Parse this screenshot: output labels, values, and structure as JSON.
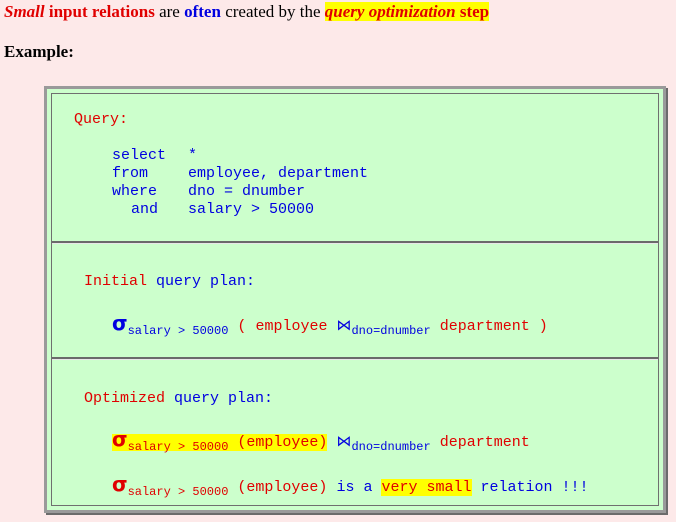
{
  "headline": {
    "small": "Small",
    "input_relations": "input relations",
    "are": "are",
    "often": "often",
    "created_by_the": "created by the",
    "query_optimization": "query optimization",
    "step": "step"
  },
  "example_label": "Example:",
  "query_section": {
    "label": "Query:",
    "lines": [
      {
        "kw": "select",
        "val": "*"
      },
      {
        "kw": "from",
        "val": "employee, department"
      },
      {
        "kw": "where",
        "val": "dno = dnumber"
      },
      {
        "kw": "and",
        "val": "salary > 50000"
      }
    ]
  },
  "initial_plan": {
    "label_a": "Initial",
    "label_b": "query plan:",
    "sigma": "σ",
    "sigma_sub": "salary > 50000",
    "open_paren": "(",
    "employee": "employee",
    "join": "⋈",
    "join_sub": "dno=dnumber",
    "department": "department",
    "close_paren": ")"
  },
  "optimized_plan": {
    "label_a": "Optimized",
    "label_b": "query plan:",
    "sigma": "σ",
    "sigma_sub": "salary > 50000",
    "employee_paren": "(employee)",
    "join": "⋈",
    "join_sub": "dno=dnumber",
    "department": "department",
    "note": {
      "sigma": "σ",
      "sigma_sub": "salary > 50000",
      "employee_paren": "(employee)",
      "is_a": "is a",
      "very_small": "very small",
      "relation": "relation !!!"
    }
  },
  "colors": {
    "background": "#fde9e9",
    "box_background": "#ccffcc",
    "red": "#e00000",
    "blue": "#0000e0",
    "highlight": "#ffff00"
  }
}
